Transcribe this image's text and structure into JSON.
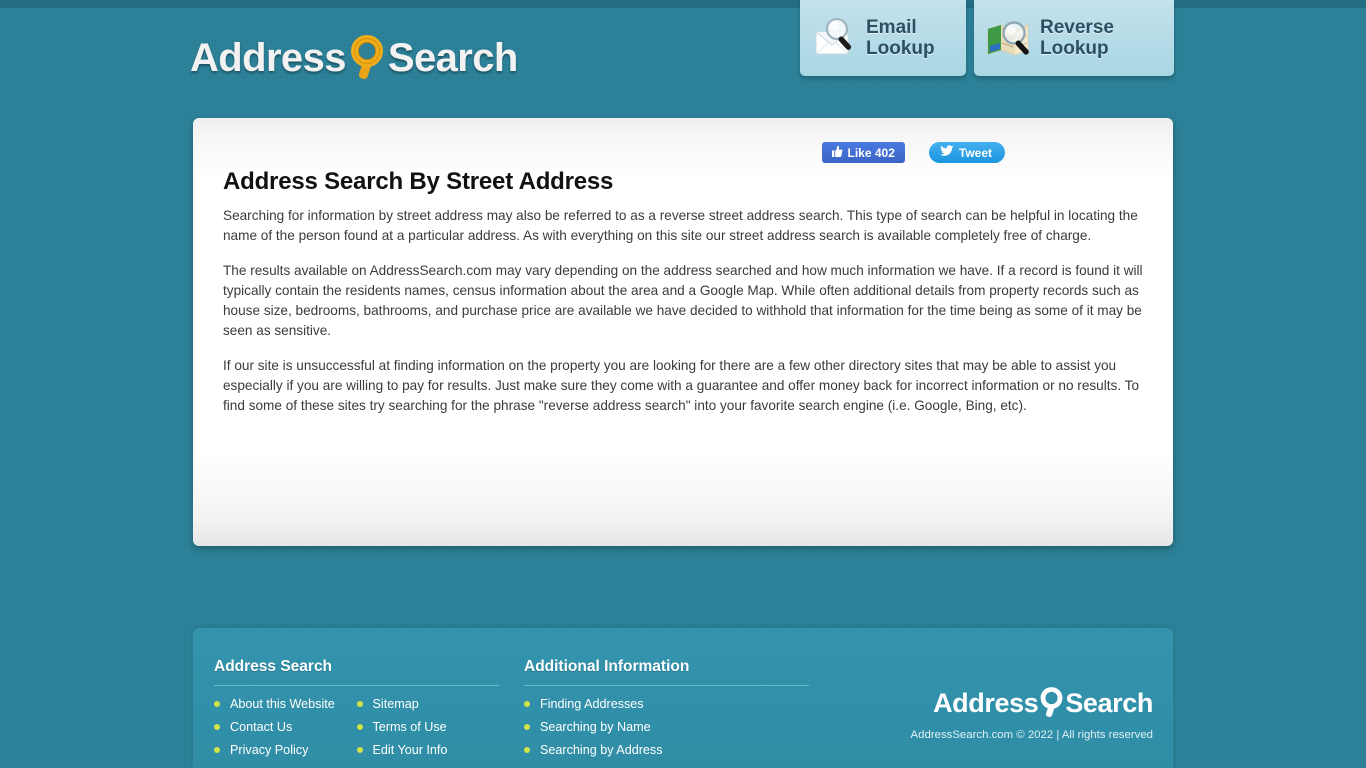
{
  "brand": {
    "name_part1": "Address",
    "name_part2": "Search",
    "icon": "magnifier-icon"
  },
  "header": {
    "tabs": [
      {
        "label": "Email\nLookup",
        "icon": "envelope-magnifier-icon",
        "name": "email-lookup"
      },
      {
        "label": "Reverse\nLookup",
        "icon": "map-magnifier-icon",
        "name": "reverse-lookup"
      }
    ]
  },
  "social": {
    "facebook": {
      "label": "Like 402",
      "icon": "thumbs-up-icon",
      "color": "#3a63c6"
    },
    "twitter": {
      "label": "Tweet",
      "icon": "twitter-bird-icon",
      "color": "#1b95e0"
    }
  },
  "main": {
    "title": "Address Search By Street Address",
    "paragraphs": [
      "Searching for information by street address may also be referred to as a reverse street address search. This type of search can be helpful in locating the name of the person found at a particular address. As with everything on this site our street address search is available completely free of charge.",
      "The results available on AddressSearch.com may vary depending on the address searched and how much information we have. If a record is found it will typically contain the residents names, census information about the area and a Google Map. While often additional details from property records such as house size, bedrooms, bathrooms, and purchase price are available we have decided to withhold that information for the time being as some of it may be seen as sensitive.",
      "If our site is unsuccessful at finding information on the property you are looking for there are a few other directory sites that may be able to assist you especially if you are willing to pay for results. Just make sure they come with a guarantee and offer money back for incorrect information or no results. To find some of these sites try searching for the phrase \"reverse address search\" into your favorite search engine (i.e. Google, Bing, etc)."
    ]
  },
  "footer": {
    "columns": [
      {
        "heading": "Address Search",
        "lists": [
          [
            "About this Website",
            "Contact Us",
            "Privacy Policy"
          ],
          [
            "Sitemap",
            "Terms of Use",
            "Edit Your Info"
          ]
        ]
      },
      {
        "heading": "Additional Information",
        "lists": [
          [
            "Finding Addresses",
            "Searching by Name",
            "Searching by Address"
          ]
        ]
      }
    ],
    "copyright": "AddressSearch.com © 2022 | All rights reserved"
  },
  "colors": {
    "background": "#2a8199",
    "footer_panel": "#3494ad",
    "tab_panel": "#b9dde9",
    "bullet": "#d2e34a",
    "logo_accent": "#e8a317"
  }
}
